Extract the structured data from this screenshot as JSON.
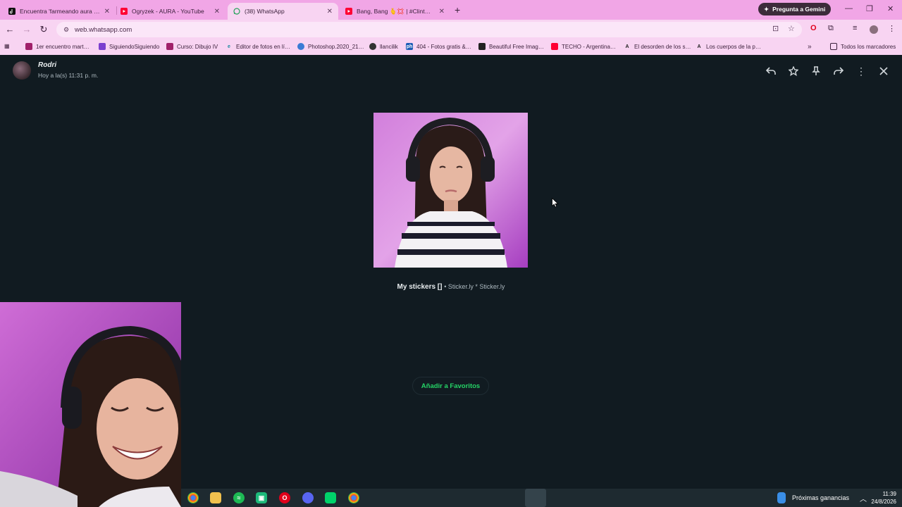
{
  "browser": {
    "tabs": [
      {
        "title": "Encuentra 'farmeando aura co…",
        "favicon": "tiktok-icon",
        "color": "#111111"
      },
      {
        "title": "Ogryzek - AURA - YouTube",
        "favicon": "youtube-icon",
        "color": "#ff0033"
      },
      {
        "title": "(38) WhatsApp",
        "favicon": "whatsapp-icon",
        "color": "#25d366",
        "active": true
      },
      {
        "title": "Bang, Bang 🫰💢 | #ClintEast…",
        "favicon": "youtube-icon",
        "color": "#ff0033"
      }
    ],
    "new_tab": "+",
    "gemini_label": "Pregunta a Gemini",
    "url": "web.whatsapp.com",
    "bookmarks": [
      "1er encuentro mart…",
      "SiguiendoSiguiendo",
      "Curso: Dibujo IV",
      "Editor de fotos en lí…",
      "Photoshop.2020_21…",
      "llancilik",
      "404 - Fotos gratis &…",
      "Beautiful Free Imag…",
      "TECHO - Argentina…",
      "El desorden de los s…",
      "Los cuerpos de la p…"
    ],
    "bookmarks_overflow": "»",
    "all_bookmarks": "Todos los marcadores"
  },
  "viewer": {
    "sender": "Rodri",
    "timestamp": "Hoy a la(s) 11:31 p. m.",
    "actions": [
      "reply-icon",
      "star-icon",
      "pin-icon",
      "forward-icon",
      "more-icon",
      "close-icon"
    ],
    "sticker_pack": "My stickers []",
    "sticker_meta": "• Sticker.ly * Sticker.ly",
    "favorite_button": "Añadir a Favoritos"
  },
  "taskbar": {
    "apps": [
      "chrome-icon",
      "file-explorer-icon",
      "spotify-icon",
      "app-icon",
      "opera-icon",
      "discord-icon",
      "capcut-icon",
      "chrome-icon"
    ],
    "widget_label": "Próximas ganancias",
    "time": "11:39",
    "date": "24/8/2026"
  }
}
